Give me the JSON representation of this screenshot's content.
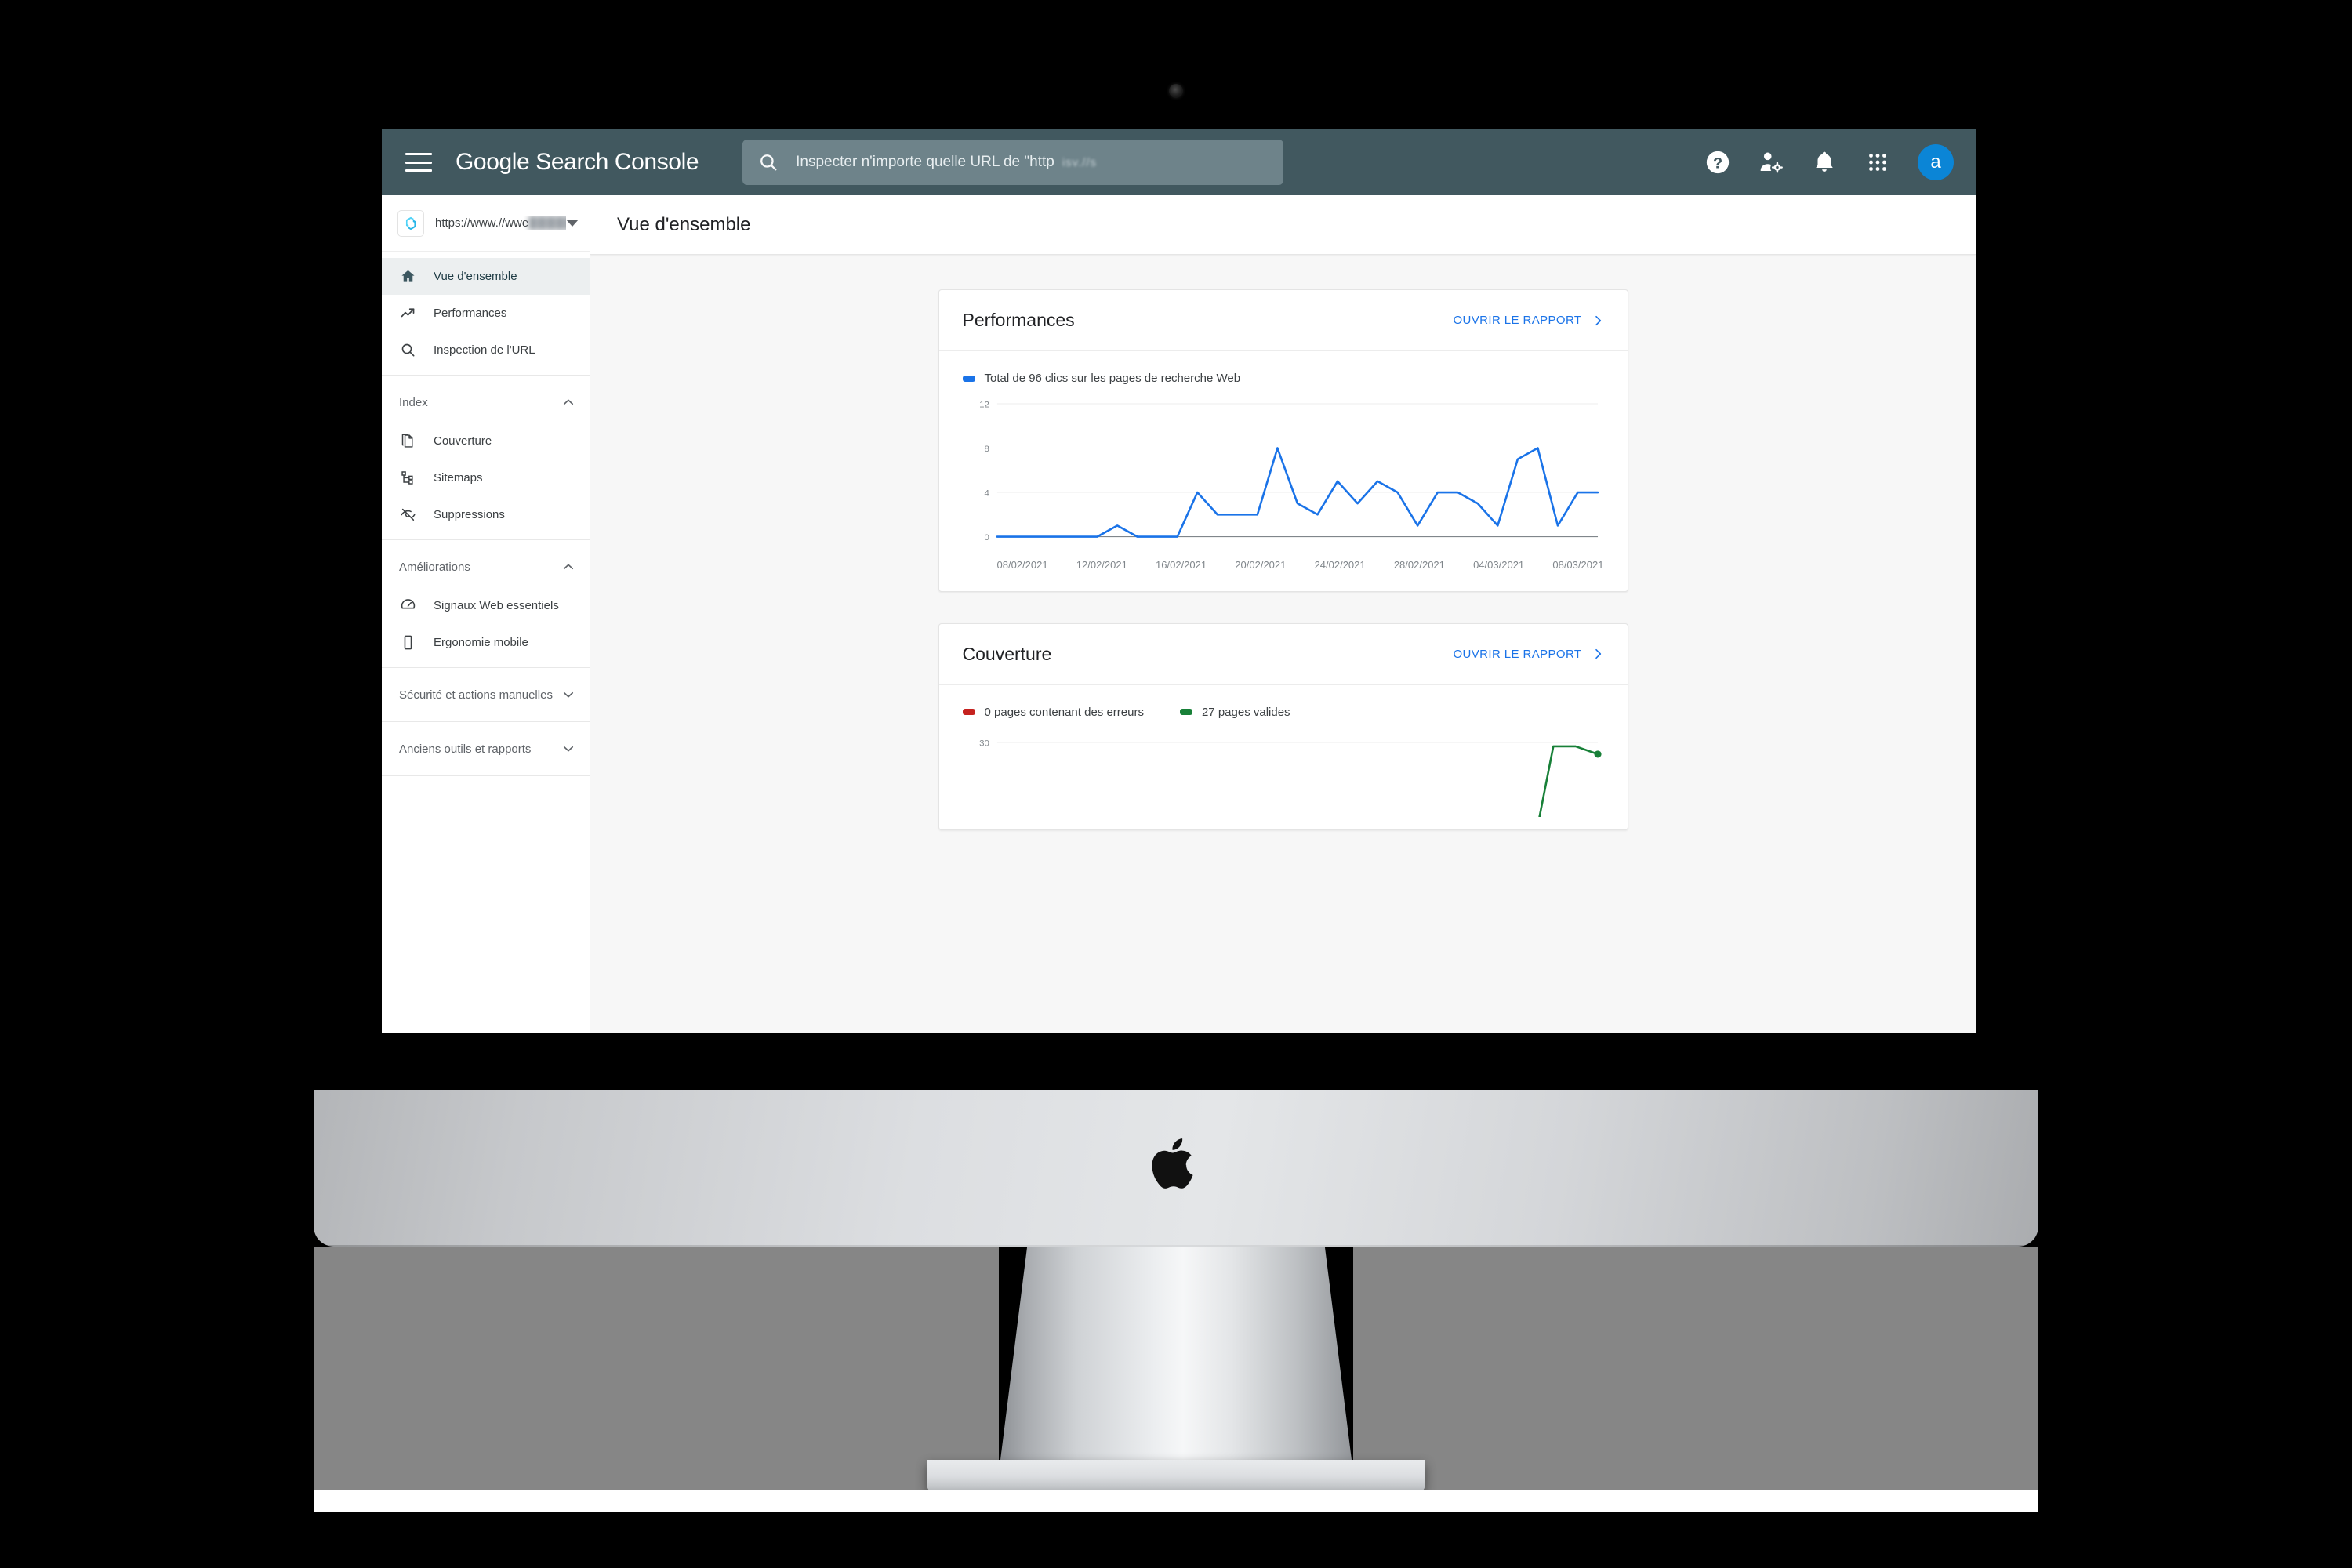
{
  "app": {
    "brand": "Google Search Console",
    "menu_icon": "hamburger-icon",
    "page_title": "Vue d'ensemble"
  },
  "search": {
    "icon": "search-icon",
    "placeholder": "Inspecter n'importe quelle URL de \"http",
    "blurred_suffix": "isv.//s"
  },
  "appbar_actions": [
    {
      "name": "help-icon",
      "label": "Aide"
    },
    {
      "name": "account-settings-icon",
      "label": "Paramètres du compte"
    },
    {
      "name": "notifications-bell-icon",
      "label": "Notifications"
    },
    {
      "name": "apps-grid-icon",
      "label": "Applications Google"
    }
  ],
  "avatar": {
    "initial": "a",
    "color": "#0b85d6"
  },
  "property": {
    "logo": "c-hexagon-logo",
    "url_visible": "https://www.//wwe",
    "url_blurred": "██████",
    "dropdown_icon": "chevron-down-icon"
  },
  "sidebar": {
    "primary": [
      {
        "id": "overview",
        "label": "Vue d'ensemble",
        "icon": "home-icon",
        "active": true
      },
      {
        "id": "performance",
        "label": "Performances",
        "icon": "trending-up-icon",
        "active": false
      },
      {
        "id": "url-inspection",
        "label": "Inspection de l'URL",
        "icon": "search-icon",
        "active": false
      }
    ],
    "groups": [
      {
        "id": "index",
        "label": "Index",
        "expanded": true,
        "chevron": "chevron-up-icon",
        "items": [
          {
            "id": "coverage",
            "label": "Couverture",
            "icon": "pages-copy-icon"
          },
          {
            "id": "sitemaps",
            "label": "Sitemaps",
            "icon": "sitemap-icon"
          },
          {
            "id": "removals",
            "label": "Suppressions",
            "icon": "eye-off-icon"
          }
        ]
      },
      {
        "id": "enhancements",
        "label": "Améliorations",
        "expanded": true,
        "chevron": "chevron-up-icon",
        "items": [
          {
            "id": "web-vitals",
            "label": "Signaux Web essentiels",
            "icon": "speedometer-icon"
          },
          {
            "id": "mobile-usab",
            "label": "Ergonomie mobile",
            "icon": "mobile-phone-icon"
          }
        ]
      },
      {
        "id": "security",
        "label": "Sécurité et actions manuelles",
        "expanded": false,
        "chevron": "chevron-down-icon",
        "items": []
      },
      {
        "id": "legacy-tools",
        "label": "Anciens outils et rapports",
        "expanded": false,
        "chevron": "chevron-down-icon",
        "items": []
      }
    ]
  },
  "cards": {
    "performance": {
      "title": "Performances",
      "open_report_label": "OUVRIR LE RAPPORT",
      "open_report_icon": "chevron-right-icon",
      "legend": [
        {
          "label": "Total de 96 clics sur les pages de recherche Web",
          "color": "#1a73e8"
        }
      ]
    },
    "coverage": {
      "title": "Couverture",
      "open_report_label": "OUVRIR LE RAPPORT",
      "open_report_icon": "chevron-right-icon",
      "legend": [
        {
          "label": "0 pages contenant des erreurs",
          "color": "#c5221f"
        },
        {
          "label": "27 pages valides",
          "color": "#188038"
        }
      ]
    }
  },
  "chart_data": [
    {
      "id": "performance-clicks",
      "type": "line",
      "title": "Total de 96 clics sur les pages de recherche Web",
      "xlabel": "",
      "ylabel": "",
      "ylim": [
        0,
        12
      ],
      "yticks": [
        0,
        4,
        8,
        12
      ],
      "grid": true,
      "legend_position": "top-left",
      "color": "#1a73e8",
      "xticks": [
        "08/02/2021",
        "12/02/2021",
        "16/02/2021",
        "20/02/2021",
        "24/02/2021",
        "28/02/2021",
        "04/03/2021",
        "08/03/2021"
      ],
      "x": [
        "07/02/2021",
        "08/02/2021",
        "09/02/2021",
        "10/02/2021",
        "11/02/2021",
        "12/02/2021",
        "13/02/2021",
        "14/02/2021",
        "15/02/2021",
        "16/02/2021",
        "17/02/2021",
        "18/02/2021",
        "19/02/2021",
        "20/02/2021",
        "21/02/2021",
        "22/02/2021",
        "23/02/2021",
        "24/02/2021",
        "25/02/2021",
        "26/02/2021",
        "27/02/2021",
        "28/02/2021",
        "01/03/2021",
        "02/03/2021",
        "03/03/2021",
        "04/03/2021",
        "05/03/2021",
        "06/03/2021",
        "07/03/2021",
        "08/03/2021",
        "09/03/2021"
      ],
      "values": [
        0,
        0,
        0,
        0,
        0,
        0,
        1,
        0,
        0,
        0,
        4,
        2,
        2,
        2,
        8,
        3,
        2,
        5,
        3,
        5,
        4,
        1,
        4,
        4,
        3,
        1,
        7,
        8,
        1,
        4,
        4
      ],
      "total_label": "96"
    },
    {
      "id": "coverage-pages",
      "type": "line",
      "title": "Couverture",
      "ylim": [
        0,
        30
      ],
      "yticks": [
        30
      ],
      "grid": true,
      "legend_position": "top-left",
      "series": [
        {
          "name": "0 pages contenant des erreurs",
          "color": "#c5221f",
          "values": [
            0,
            0,
            0,
            0,
            0,
            0,
            0,
            0,
            0,
            0,
            0,
            0,
            0,
            0,
            0,
            0,
            0,
            0,
            0,
            0,
            0,
            0,
            0,
            0,
            0,
            0,
            0,
            0
          ]
        },
        {
          "name": "27 pages valides",
          "color": "#188038",
          "values": [
            0,
            0,
            0,
            0,
            0,
            0,
            0,
            0,
            0,
            0,
            0,
            0,
            0,
            0,
            0,
            0,
            0,
            0,
            0,
            0,
            0,
            0,
            0,
            0,
            0,
            29,
            29,
            27
          ]
        }
      ]
    }
  ]
}
